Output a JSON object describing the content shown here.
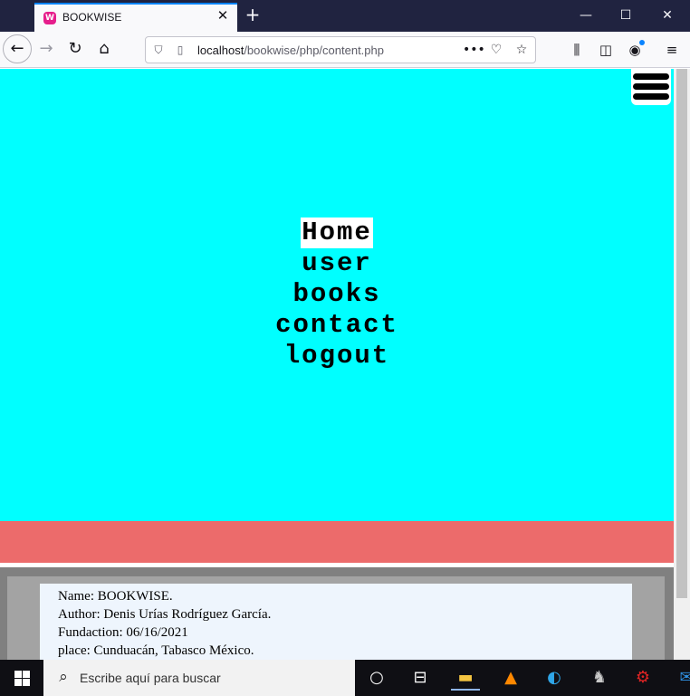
{
  "browser": {
    "tab_title": "BOOKWISE",
    "favicon_letter": "W",
    "url_host": "localhost",
    "url_path": "/bookwise/php/content.php"
  },
  "menu": {
    "items": [
      {
        "label": "Home",
        "active": true
      },
      {
        "label": "user",
        "active": false
      },
      {
        "label": "books",
        "active": false
      },
      {
        "label": "contact",
        "active": false
      },
      {
        "label": "logout",
        "active": false
      }
    ]
  },
  "footer": {
    "lines": [
      "Name: BOOKWISE.",
      "Author: Denis Urías Rodríguez García.",
      "Fundaction: 06/16/2021",
      "place: Cunduacán, Tabasco México."
    ]
  },
  "taskbar": {
    "search_placeholder": "Escribe aquí para buscar"
  },
  "colors": {
    "hero_background": "#00ffff",
    "band_red": "#ec6b6b",
    "footer_gray": "#808080",
    "card_background": "#eef5fd"
  }
}
